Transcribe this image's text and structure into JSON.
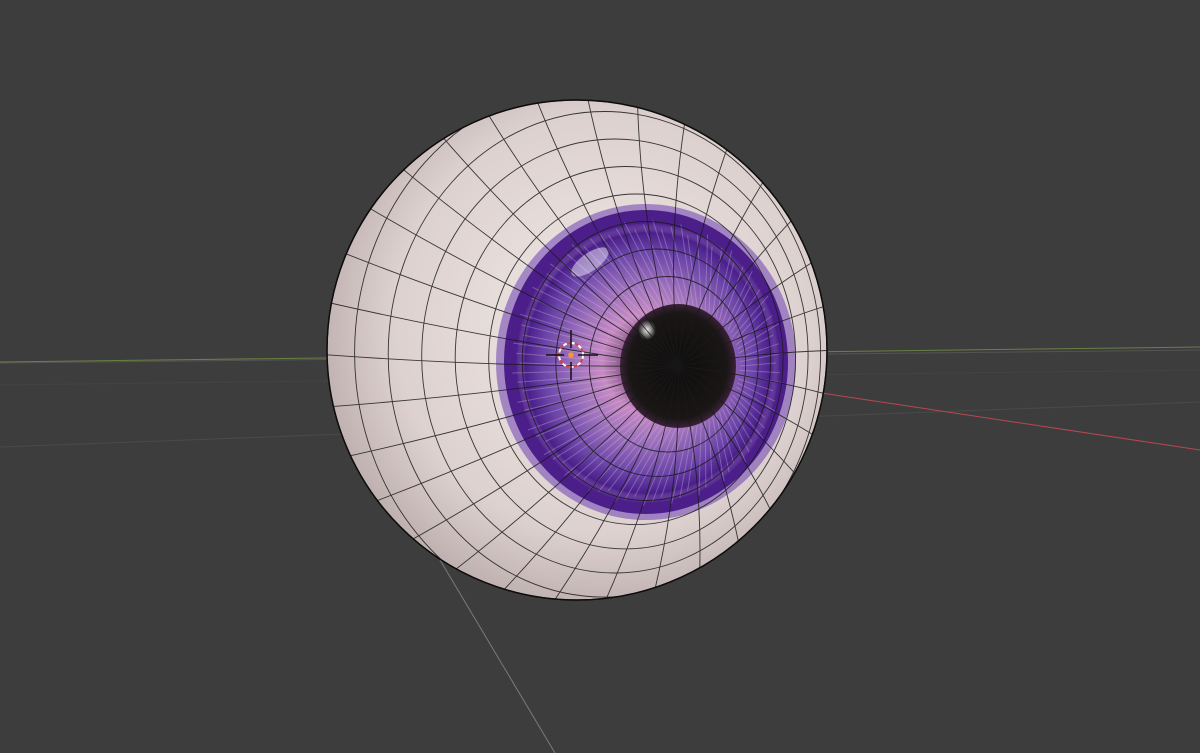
{
  "viewport": {
    "background": "#3d3d3d",
    "object": "eyeball",
    "shading": "textured",
    "overlay": "wireframe"
  },
  "colors": {
    "background": "#3d3d3d",
    "grid_line": "#474747",
    "x_axis": "#c0484f",
    "y_axis": "#7a9a3c",
    "sclera": "#e3d8d6",
    "iris_outer": "#4b1e8a",
    "iris_inner": "#9c6fb6",
    "pupil": "#141212",
    "wire": "#1a1a1a",
    "origin_point": "#f39a2c",
    "cursor_ring_red": "#d84040",
    "cursor_ring_white": "#ffffff"
  },
  "icons": {
    "cursor": "3d-cursor-icon",
    "origin": "origin-point-icon"
  }
}
